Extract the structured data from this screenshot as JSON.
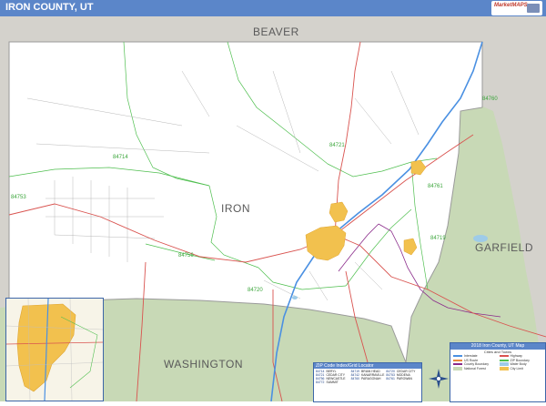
{
  "title": "IRON COUNTY, UT",
  "logo": {
    "text": "MarketMAPS"
  },
  "colors": {
    "title_bar": "#5b86c9",
    "neighbor_county": "#d4d2cc",
    "national_forest": "#c8d9b6",
    "county_interior": "#ffffff",
    "zip_boundary": "#4fbf4f",
    "city_fill": "#f2c14e",
    "county_boundary": "#8a2a8a",
    "interstate": "#4a90e2",
    "major_road": "#d9534f",
    "minor_road": "#b8b8b8"
  },
  "neighbor_counties": [
    {
      "name": "BEAVER"
    },
    {
      "name": "GARFIELD"
    },
    {
      "name": "WASHINGTON"
    }
  ],
  "county_label": "IRON",
  "zip_labels": [
    {
      "code": "84714"
    },
    {
      "code": "84753"
    },
    {
      "code": "84720"
    },
    {
      "code": "84721"
    },
    {
      "code": "84761"
    },
    {
      "code": "84719"
    },
    {
      "code": "84760"
    },
    {
      "code": "84756"
    }
  ],
  "zip_index": {
    "title": "ZIP Code Index/Grid Locator",
    "entries": [
      {
        "zip": "84714",
        "city": "BERYL"
      },
      {
        "zip": "84719",
        "city": "BRIAN HEAD"
      },
      {
        "zip": "84720",
        "city": "CEDAR CITY"
      },
      {
        "zip": "84721",
        "city": "CEDAR CITY"
      },
      {
        "zip": "84742",
        "city": "KANARRAVILLE"
      },
      {
        "zip": "84753",
        "city": "MODENA"
      },
      {
        "zip": "84756",
        "city": "NEWCASTLE"
      },
      {
        "zip": "84760",
        "city": "PARAGONAH"
      },
      {
        "zip": "84761",
        "city": "PAROWAN"
      },
      {
        "zip": "84772",
        "city": "SUMMIT"
      }
    ]
  },
  "legend": {
    "title": "2018 Iron County, UT Map",
    "subtitle": "Cities and Towns",
    "items": [
      {
        "label": "Interstate"
      },
      {
        "label": "Highway"
      },
      {
        "label": "US Route"
      },
      {
        "label": "ZIP Boundary"
      },
      {
        "label": "County Boundary"
      },
      {
        "label": "Water Body"
      },
      {
        "label": "National Forest"
      },
      {
        "label": "City Limit"
      }
    ]
  }
}
